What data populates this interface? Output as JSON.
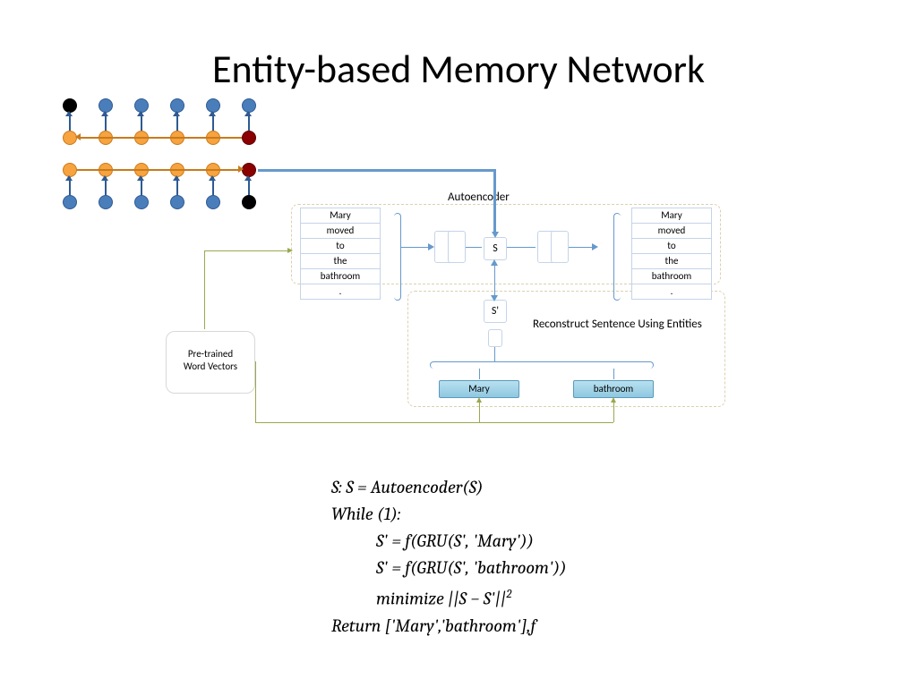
{
  "title": "Entity-based Memory Network",
  "autoencoder_label": "Autoencoder",
  "reconstruct_label": "Reconstruct Sentence Using Entities",
  "pretrained_label_l1": "Pre-trained",
  "pretrained_label_l2": "Word Vectors",
  "s_label": "S",
  "sprime_label": "S'",
  "sentence": [
    "Mary",
    "moved",
    "to",
    "the",
    "bathroom",
    "."
  ],
  "entities": [
    "Mary",
    "bathroom"
  ],
  "algorithm": {
    "line1": "S: S = Autoencoder(S)",
    "line2": "While (1):",
    "line3": "S' = f(GRU(S', 'Mary'))",
    "line4": "S' = f(GRU(S', 'bathroom'))",
    "line5": "minimize ||S − S'||²",
    "line6": "Return ['Mary','bathroom'],f"
  }
}
